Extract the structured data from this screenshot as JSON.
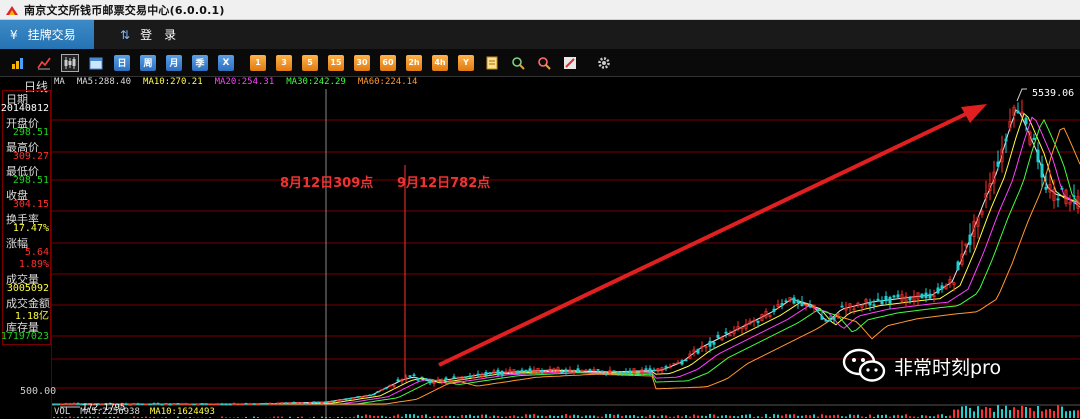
{
  "window": {
    "title": "南京文交所钱币邮票交易中心(6.0.0.1)"
  },
  "menu": {
    "tabs": [
      {
        "icon": "¥",
        "label": "挂牌交易"
      },
      {
        "icon": "⇅",
        "label": "登　录"
      }
    ]
  },
  "toolbar": {
    "period_buttons": [
      "日",
      "周",
      "月",
      "季",
      "X"
    ],
    "minute_buttons": [
      "1",
      "3",
      "5",
      "15",
      "30",
      "60",
      "2h",
      "4h",
      "Y"
    ]
  },
  "panel": {
    "header": "日线",
    "rows": [
      {
        "label": "日期",
        "value": "20140812",
        "color": "#ffffff"
      },
      {
        "label": "开盘价",
        "value": "298.51",
        "color": "#20d020"
      },
      {
        "label": "最高价",
        "value": "309.27",
        "color": "#ff3030"
      },
      {
        "label": "最低价",
        "value": "298.51",
        "color": "#20d020"
      },
      {
        "label": "收盘",
        "value": "304.15",
        "color": "#ff3030"
      },
      {
        "label": "换手率",
        "value": "17.47%",
        "color": "#ffff40"
      },
      {
        "label": "涨幅",
        "value": "5.64",
        "color": "#ff3030"
      },
      {
        "label": "",
        "value": "1.89%",
        "color": "#ff3030"
      },
      {
        "label": "成交量",
        "value": "3005092",
        "color": "#ffff40"
      },
      {
        "label": "成交金额",
        "value": "1.18亿",
        "color": "#ffff40"
      },
      {
        "label": "库存量",
        "value": "17197023",
        "color": "#20d020"
      }
    ]
  },
  "ma_line": [
    {
      "text": "MA",
      "color": "#dddddd"
    },
    {
      "text": "MA5:288.40",
      "color": "#dddddd"
    },
    {
      "text": "MA10:270.21",
      "color": "#ffff40"
    },
    {
      "text": "MA20:254.31",
      "color": "#ff40ff"
    },
    {
      "text": "MA30:242.29",
      "color": "#40ff40"
    },
    {
      "text": "MA60:224.14",
      "color": "#ff9a30"
    }
  ],
  "vol_line": [
    {
      "text": "VOL",
      "color": "#dddddd"
    },
    {
      "text": "MA5:2256938",
      "color": "#dddddd"
    },
    {
      "text": "MA10:1624493",
      "color": "#ffff40"
    }
  ],
  "annotations": {
    "aug": "8月12日309点",
    "sep": "9月12日782点",
    "peak": "5539.06",
    "low": "172.1795",
    "axis_500": "500.00"
  },
  "watermark": {
    "text": "非常时刻pro"
  },
  "colors": {
    "grid": "#7a0000",
    "arrow": "#e02020",
    "up": "#ff3030",
    "down": "#20d0d0"
  }
}
